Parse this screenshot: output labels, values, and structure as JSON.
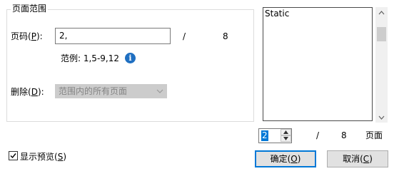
{
  "page_range": {
    "group_title": "页面范围",
    "pages_label": "页码(",
    "pages_mnemonic": "P",
    "pages_label_end": "):",
    "pages_value": "2,",
    "slash": "/",
    "total_pages": "8",
    "example_text": "范例: 1,5-9,12",
    "info_icon": "i",
    "subset_label": "删除(",
    "subset_mnemonic": "D",
    "subset_label_end": "):",
    "subset_value": "范围内的所有页面"
  },
  "preview": {
    "text": "Static"
  },
  "navigator": {
    "current_page": "2",
    "slash": "/",
    "total": "8",
    "unit_label": "页面"
  },
  "show_preview": {
    "label": "显示预览(",
    "mnemonic": "S",
    "label_end": ")",
    "checked": true
  },
  "buttons": {
    "ok": {
      "label": "确定(",
      "mnemonic": "O",
      "end": ")"
    },
    "cancel": {
      "label": "取消(",
      "mnemonic": "C",
      "end": ")"
    }
  },
  "colors": {
    "accent": "#0078d7",
    "info_icon": "#1f6fc1",
    "disabled_bg": "#cccccc",
    "disabled_text": "#838383"
  }
}
